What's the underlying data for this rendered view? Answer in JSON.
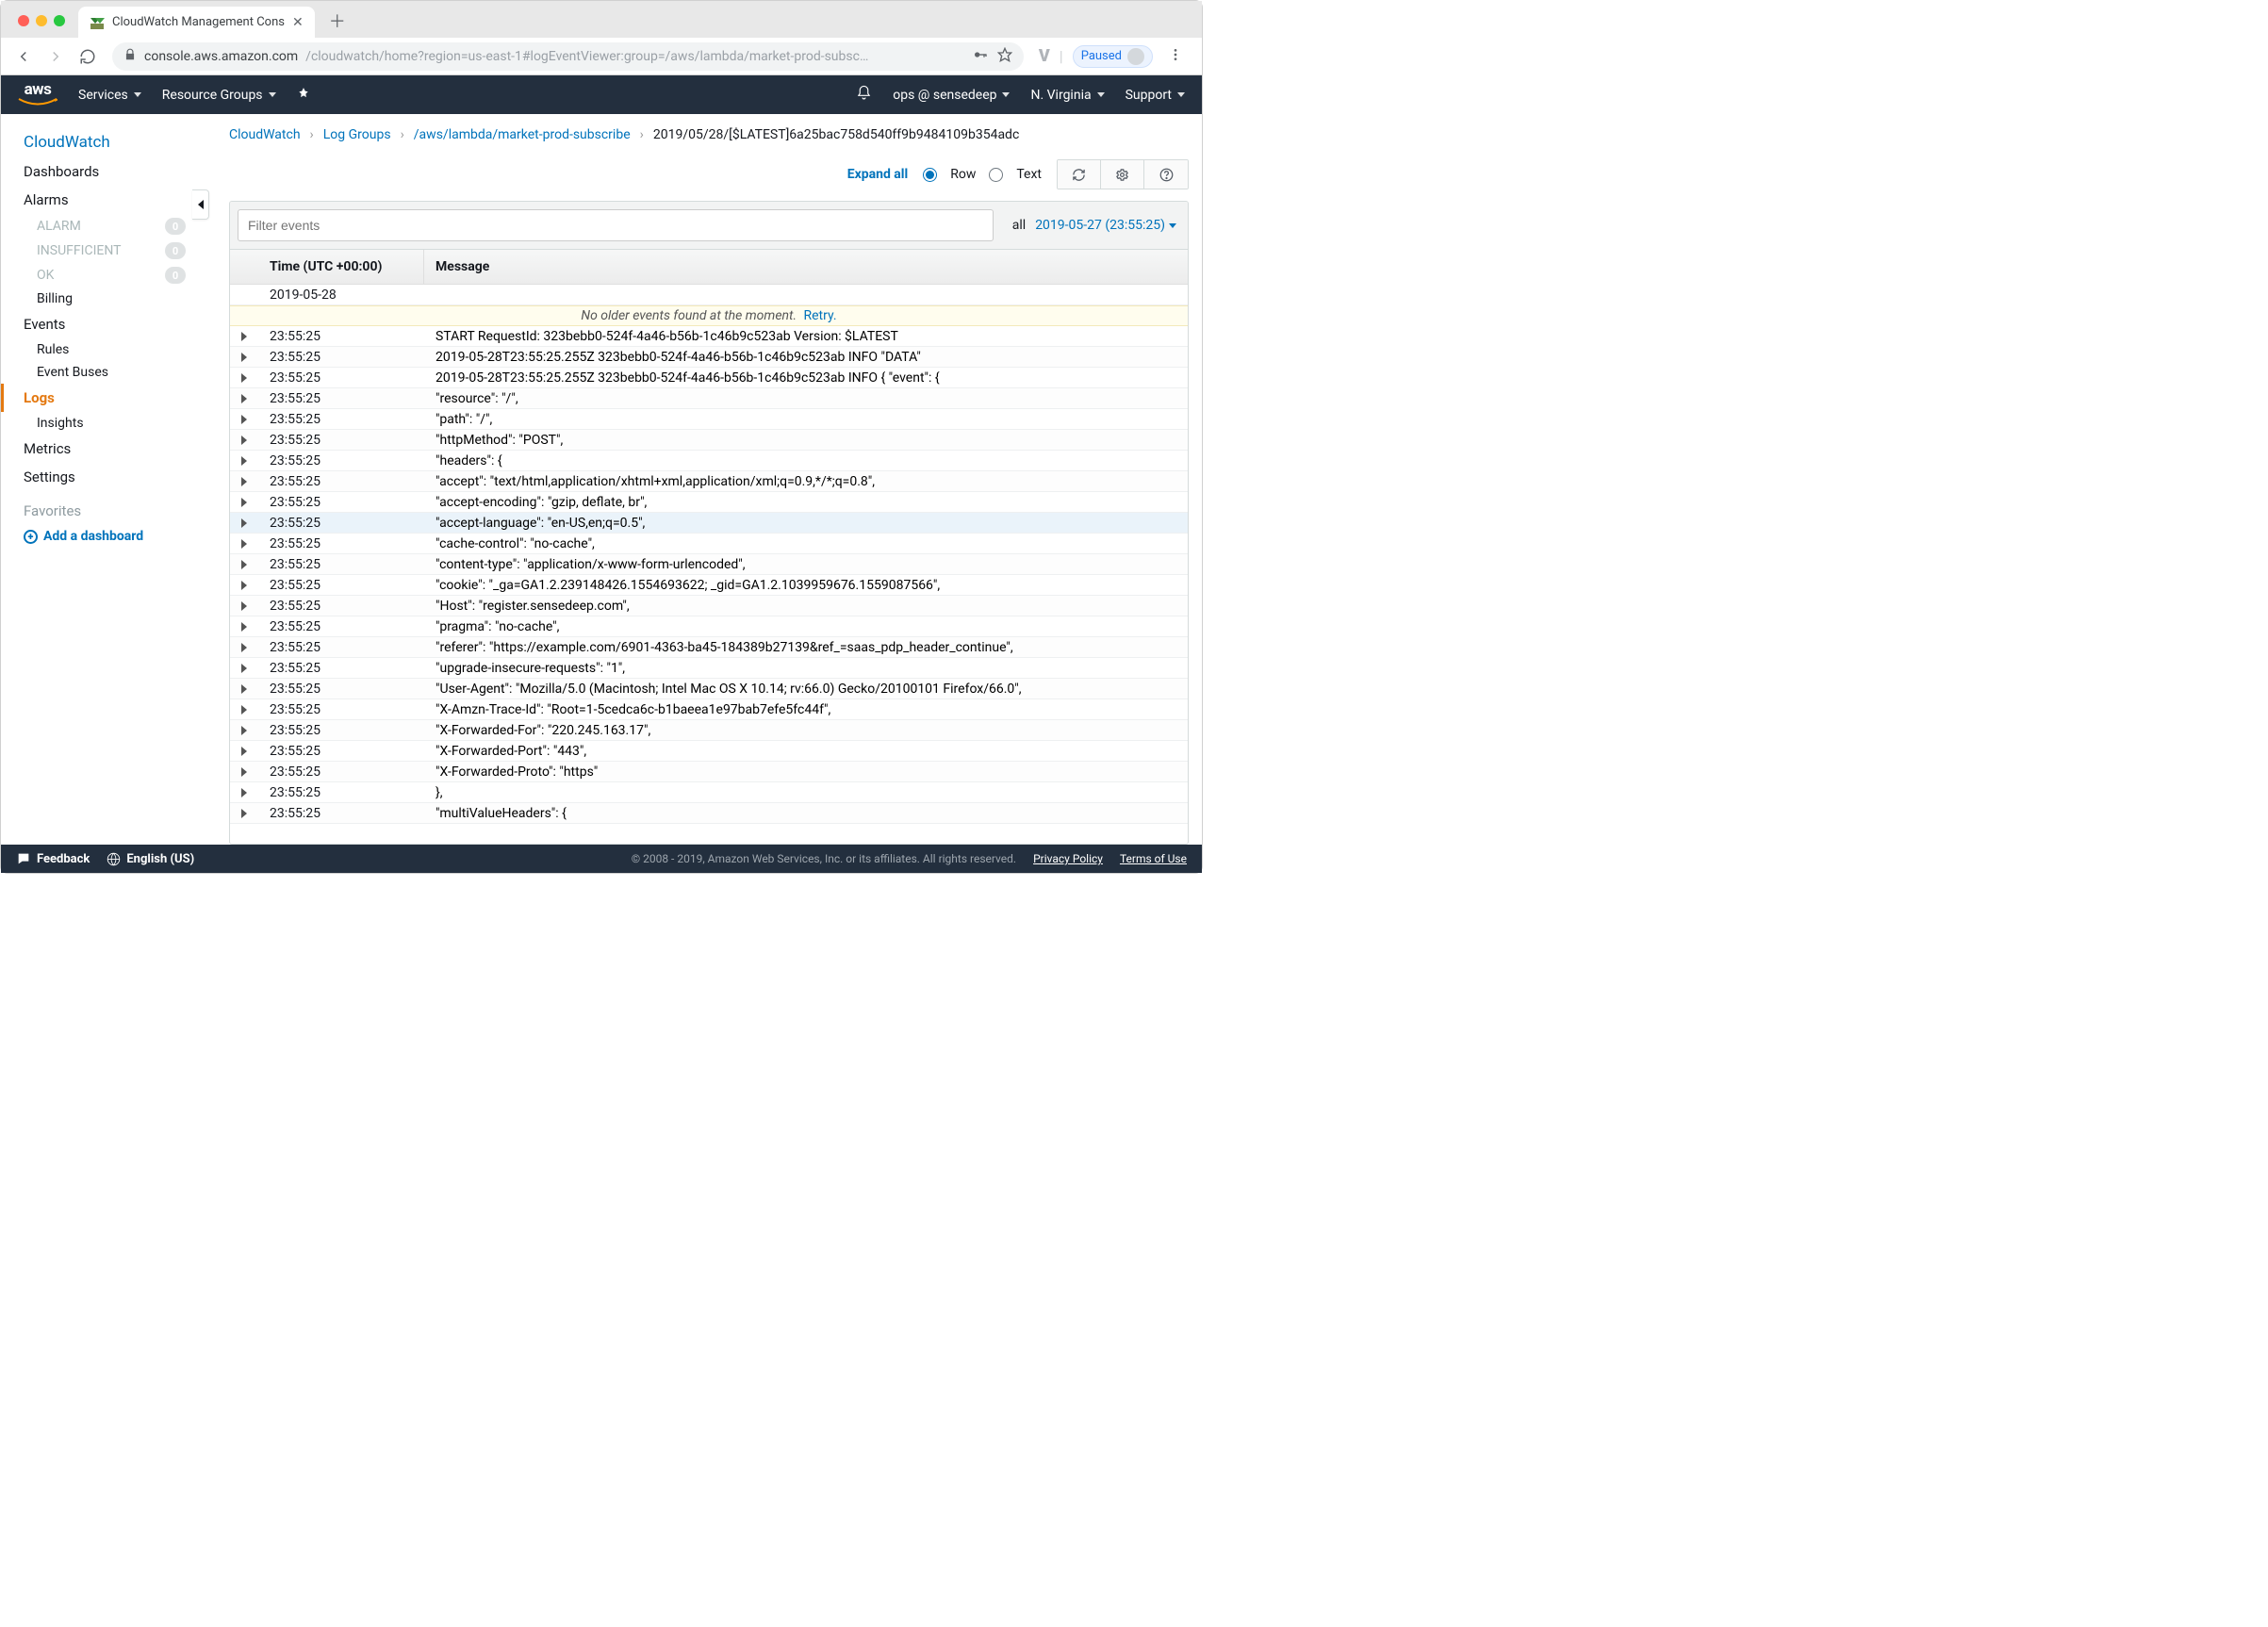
{
  "browser": {
    "tab_title": "CloudWatch Management Cons",
    "url_host": "console.aws.amazon.com",
    "url_path": "/cloudwatch/home?region=us-east-1#logEventViewer:group=/aws/lambda/market-prod-subsc…",
    "paused_label": "Paused"
  },
  "navbar": {
    "logo": "aws",
    "services": "Services",
    "resource_groups": "Resource Groups",
    "account": "ops @ sensedeep",
    "region": "N. Virginia",
    "support": "Support"
  },
  "sidebar": {
    "brand": "CloudWatch",
    "items": [
      {
        "kind": "sec",
        "label": "Dashboards"
      },
      {
        "kind": "sec",
        "label": "Alarms"
      },
      {
        "kind": "sub",
        "label": "ALARM",
        "badge": "0",
        "muted": true
      },
      {
        "kind": "sub",
        "label": "INSUFFICIENT",
        "badge": "0",
        "muted": true
      },
      {
        "kind": "sub",
        "label": "OK",
        "badge": "0",
        "muted": true
      },
      {
        "kind": "sub",
        "label": "Billing",
        "live": true
      },
      {
        "kind": "sec",
        "label": "Events"
      },
      {
        "kind": "sub",
        "label": "Rules",
        "live": true
      },
      {
        "kind": "sub",
        "label": "Event Buses",
        "live": true
      },
      {
        "kind": "active",
        "label": "Logs"
      },
      {
        "kind": "sub",
        "label": "Insights",
        "live": true
      },
      {
        "kind": "sec",
        "label": "Metrics"
      },
      {
        "kind": "sec",
        "label": "Settings"
      }
    ],
    "favorites_label": "Favorites",
    "add_dashboard": "Add a dashboard"
  },
  "breadcrumb": {
    "items": [
      "CloudWatch",
      "Log Groups",
      "/aws/lambda/market-prod-subscribe"
    ],
    "current": "2019/05/28/[$LATEST]6a25bac758d540ff9b9484109b354adc",
    "sep": "›"
  },
  "controls": {
    "expand_all": "Expand all",
    "row_label": "Row",
    "text_label": "Text"
  },
  "filter": {
    "placeholder": "Filter events",
    "scope_all": "all",
    "date": "2019-05-27 (23:55:25)"
  },
  "table": {
    "head_time": "Time (UTC +00:00)",
    "head_msg": "Message",
    "date_header": "2019-05-28",
    "noolder_text": "No older events found at the moment.",
    "retry": "Retry.",
    "rows": [
      {
        "t": "23:55:25",
        "m": "START RequestId: 323bebb0-524f-4a46-b56b-1c46b9c523ab Version: $LATEST"
      },
      {
        "t": "23:55:25",
        "m": "2019-05-28T23:55:25.255Z 323bebb0-524f-4a46-b56b-1c46b9c523ab INFO \"DATA\""
      },
      {
        "t": "23:55:25",
        "m": "2019-05-28T23:55:25.255Z 323bebb0-524f-4a46-b56b-1c46b9c523ab INFO { \"event\": {"
      },
      {
        "t": "23:55:25",
        "m": "\"resource\": \"/\","
      },
      {
        "t": "23:55:25",
        "m": "\"path\": \"/\","
      },
      {
        "t": "23:55:25",
        "m": "\"httpMethod\": \"POST\","
      },
      {
        "t": "23:55:25",
        "m": "\"headers\": {"
      },
      {
        "t": "23:55:25",
        "m": "\"accept\": \"text/html,application/xhtml+xml,application/xml;q=0.9,*/*;q=0.8\","
      },
      {
        "t": "23:55:25",
        "m": "\"accept-encoding\": \"gzip, deflate, br\","
      },
      {
        "t": "23:55:25",
        "m": "\"accept-language\": \"en-US,en;q=0.5\",",
        "hl": true
      },
      {
        "t": "23:55:25",
        "m": "\"cache-control\": \"no-cache\","
      },
      {
        "t": "23:55:25",
        "m": "\"content-type\": \"application/x-www-form-urlencoded\","
      },
      {
        "t": "23:55:25",
        "m": "\"cookie\": \"_ga=GA1.2.239148426.1554693622; _gid=GA1.2.1039959676.1559087566\","
      },
      {
        "t": "23:55:25",
        "m": "\"Host\": \"register.sensedeep.com\","
      },
      {
        "t": "23:55:25",
        "m": "\"pragma\": \"no-cache\","
      },
      {
        "t": "23:55:25",
        "m": "\"referer\": \"https://example.com/6901-4363-ba45-184389b27139&ref_=saas_pdp_header_continue\","
      },
      {
        "t": "23:55:25",
        "m": "\"upgrade-insecure-requests\": \"1\","
      },
      {
        "t": "23:55:25",
        "m": "\"User-Agent\": \"Mozilla/5.0 (Macintosh; Intel Mac OS X 10.14; rv:66.0) Gecko/20100101 Firefox/66.0\","
      },
      {
        "t": "23:55:25",
        "m": "\"X-Amzn-Trace-Id\": \"Root=1-5cedca6c-b1baeea1e97bab7efe5fc44f\","
      },
      {
        "t": "23:55:25",
        "m": "\"X-Forwarded-For\": \"220.245.163.17\","
      },
      {
        "t": "23:55:25",
        "m": "\"X-Forwarded-Port\": \"443\","
      },
      {
        "t": "23:55:25",
        "m": "\"X-Forwarded-Proto\": \"https\""
      },
      {
        "t": "23:55:25",
        "m": "},"
      },
      {
        "t": "23:55:25",
        "m": "\"multiValueHeaders\": {"
      }
    ]
  },
  "footer": {
    "feedback": "Feedback",
    "language": "English (US)",
    "legal": "© 2008 - 2019, Amazon Web Services, Inc. or its affiliates. All rights reserved.",
    "privacy": "Privacy Policy",
    "terms": "Terms of Use"
  }
}
